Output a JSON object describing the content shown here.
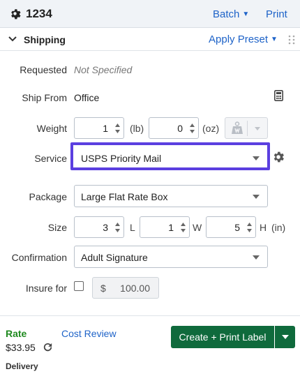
{
  "header": {
    "order_number": "1234",
    "batch_label": "Batch",
    "print_label": "Print"
  },
  "section": {
    "title": "Shipping",
    "apply_preset_label": "Apply Preset"
  },
  "form": {
    "requested": {
      "label": "Requested",
      "value": "Not Specified"
    },
    "ship_from": {
      "label": "Ship From",
      "value": "Office"
    },
    "weight": {
      "label": "Weight",
      "lb_value": "1",
      "lb_unit": "(lb)",
      "oz_value": "0",
      "oz_unit": "(oz)"
    },
    "service": {
      "label": "Service",
      "selected": "USPS Priority Mail"
    },
    "package": {
      "label": "Package",
      "selected": "Large Flat Rate Box"
    },
    "size": {
      "label": "Size",
      "length": "3",
      "l_unit": "L",
      "width": "1",
      "w_unit": "W",
      "height": "5",
      "h_unit": "H",
      "in_unit": "(in)"
    },
    "confirmation": {
      "label": "Confirmation",
      "selected": "Adult Signature"
    },
    "insure": {
      "label": "Insure for",
      "checked": false,
      "currency": "$",
      "amount": "100.00"
    }
  },
  "footer": {
    "rate_label": "Rate",
    "cost_review_label": "Cost Review",
    "rate_value": "$33.95",
    "delivery_label": "Delivery",
    "create_button_label": "Create + Print Label"
  },
  "colors": {
    "link": "#1e63c8",
    "rate_green": "#1f8a1f",
    "primary_button": "#0f6a3c",
    "focus_ring": "#5b3fe0"
  },
  "icons": [
    "gear-icon",
    "chevron-down-icon",
    "drag-handle-icon",
    "calculator-icon",
    "scale-icon",
    "settings-gear-icon",
    "refresh-icon"
  ]
}
